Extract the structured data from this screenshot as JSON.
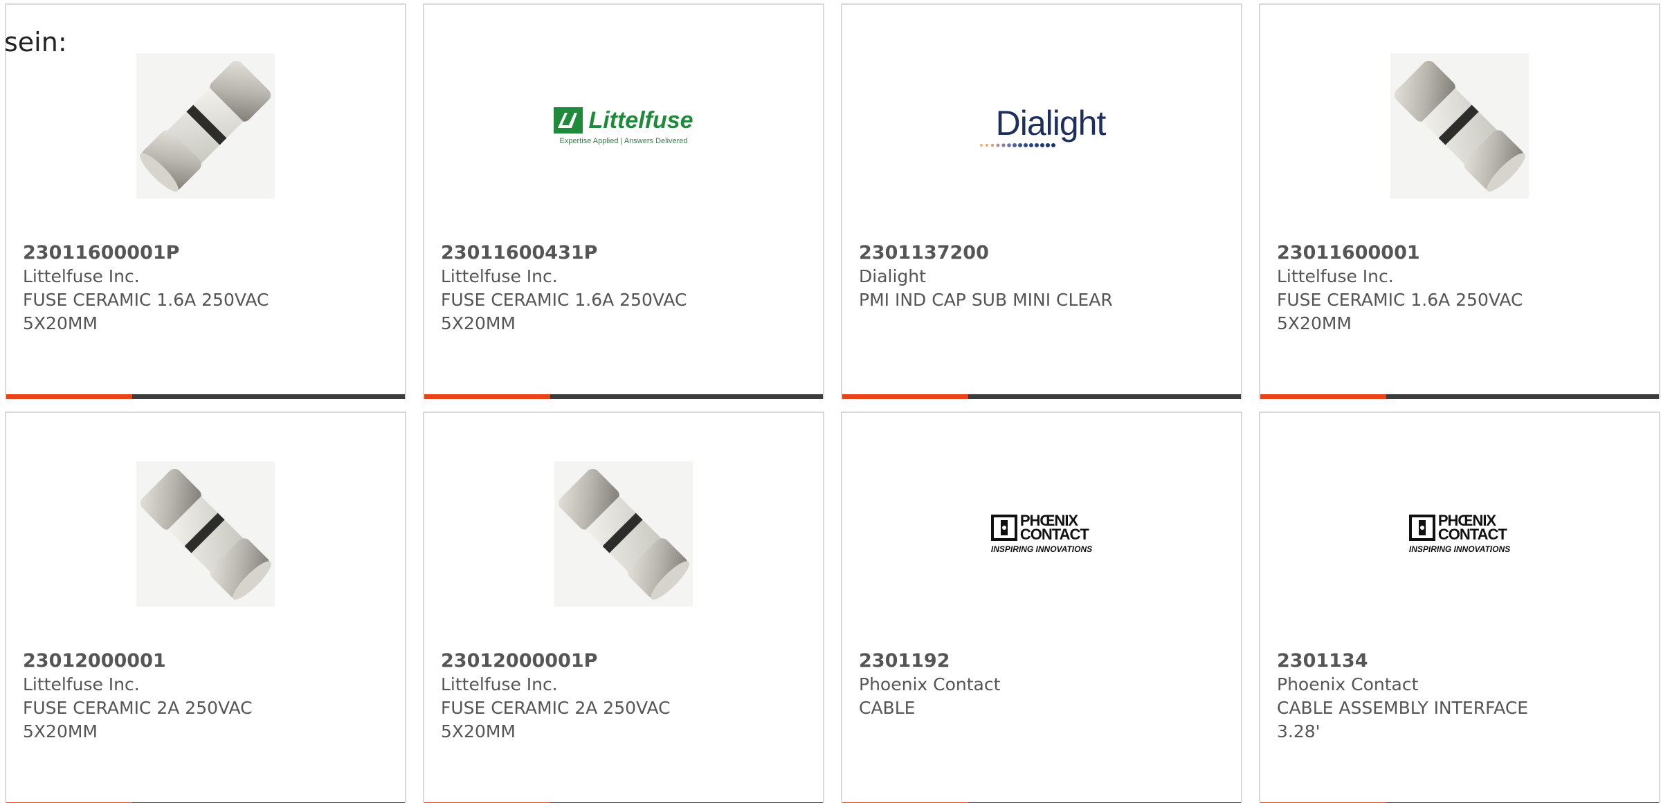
{
  "intro_text": "sein:",
  "colors": {
    "accent": "#e8441a",
    "bar_dark": "#3c3c3c",
    "card_border": "#d9d9d9",
    "text": "#555555"
  },
  "products": [
    {
      "part_number": "23011600001P",
      "manufacturer": "Littelfuse Inc.",
      "description": "FUSE CERAMIC 1.6A 250VAC 5X20MM",
      "image": "fuse-photo"
    },
    {
      "part_number": "23011600431P",
      "manufacturer": "Littelfuse Inc.",
      "description": "FUSE CERAMIC 1.6A 250VAC 5X20MM",
      "image": "littelfuse-logo",
      "logo_name": "Littelfuse",
      "logo_tagline": "Expertise Applied | Answers Delivered"
    },
    {
      "part_number": "2301137200",
      "manufacturer": "Dialight",
      "description": "PMI IND CAP SUB MINI CLEAR",
      "image": "dialight-logo",
      "logo_name": "Dialight"
    },
    {
      "part_number": "23011600001",
      "manufacturer": "Littelfuse Inc.",
      "description": "FUSE CERAMIC 1.6A 250VAC 5X20MM",
      "image": "fuse-photo"
    },
    {
      "part_number": "23012000001",
      "manufacturer": "Littelfuse Inc.",
      "description": "FUSE CERAMIC 2A 250VAC 5X20MM",
      "image": "fuse-photo"
    },
    {
      "part_number": "23012000001P",
      "manufacturer": "Littelfuse Inc.",
      "description": "FUSE CERAMIC 2A 250VAC 5X20MM",
      "image": "fuse-photo"
    },
    {
      "part_number": "2301192",
      "manufacturer": "Phoenix Contact",
      "description": "CABLE",
      "image": "phoenix-contact-logo",
      "logo_name_line1": "PHŒNIX",
      "logo_name_line2": "CONTACT",
      "logo_tagline": "INSPIRING INNOVATIONS"
    },
    {
      "part_number": "2301134",
      "manufacturer": "Phoenix Contact",
      "description": "CABLE ASSEMBLY INTERFACE 3.28'",
      "image": "phoenix-contact-logo",
      "logo_name_line1": "PHŒNIX",
      "logo_name_line2": "CONTACT",
      "logo_tagline": "INSPIRING INNOVATIONS"
    }
  ]
}
